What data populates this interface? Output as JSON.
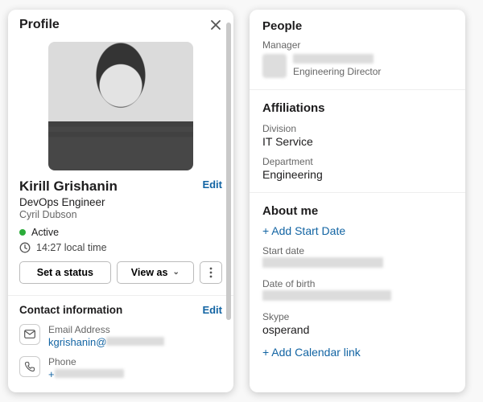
{
  "left": {
    "header": "Profile",
    "name": "Kirill Grishanin",
    "edit": "Edit",
    "role": "DevOps Engineer",
    "subrole": "Cyril Dubson",
    "status": "Active",
    "local_time": "14:27 local time",
    "btn_status": "Set a status",
    "btn_view": "View as",
    "contact_header": "Contact information",
    "email_label": "Email Address",
    "email_value": "kgrishanin@",
    "phone_label": "Phone",
    "phone_value": "+"
  },
  "right": {
    "people_header": "People",
    "manager_label": "Manager",
    "manager_role": "Engineering Director",
    "affiliations_header": "Affiliations",
    "division_label": "Division",
    "division_value": "IT Service",
    "department_label": "Department",
    "department_value": "Engineering",
    "about_header": "About me",
    "add_start": "+ Add Start Date",
    "start_label": "Start date",
    "dob_label": "Date of birth",
    "skype_label": "Skype",
    "skype_value": "osperand",
    "add_calendar": "+ Add Calendar link"
  }
}
